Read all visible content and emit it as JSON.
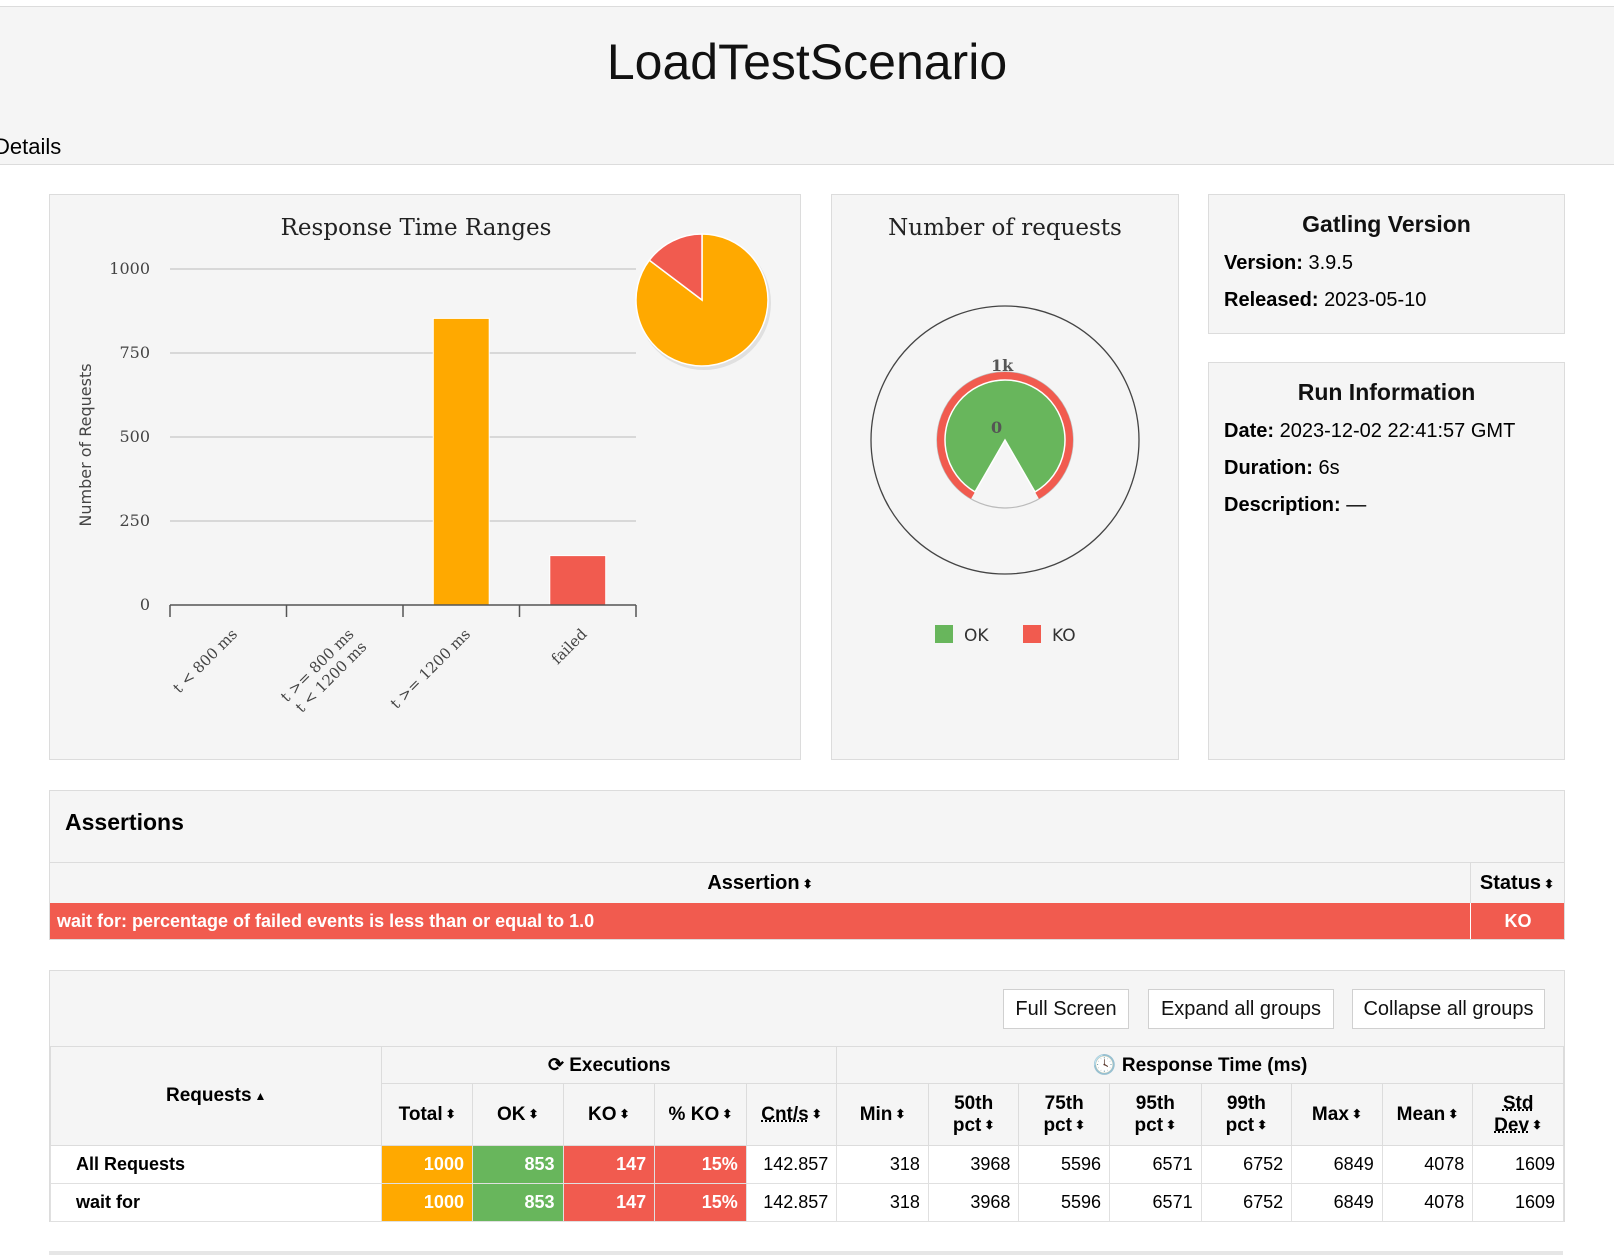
{
  "header": {
    "title": "LoadTestScenario",
    "tab": "Details"
  },
  "chart_data": [
    {
      "type": "bar",
      "title": "Response Time Ranges",
      "ylabel": "Number of Requests",
      "xlabel": "",
      "categories": [
        "t < 800 ms",
        "t >= 800 ms\nt < 1200 ms",
        "t >= 1200 ms",
        "failed"
      ],
      "values": [
        0,
        0,
        853,
        147
      ],
      "colors": [
        "#68b65c",
        "#ffdd00",
        "#ffa900",
        "#f15b4f"
      ],
      "ylim": [
        0,
        1000
      ],
      "yticks": [
        0,
        250,
        500,
        750,
        1000
      ],
      "grid": true,
      "pie": {
        "values": [
          853,
          147
        ],
        "colors": [
          "#ffa900",
          "#f15b4f"
        ]
      }
    },
    {
      "type": "pie",
      "title": "Number of requests",
      "gauge_labels": {
        "max": "1k",
        "min": "0"
      },
      "values": [
        853,
        147
      ],
      "legend": [
        "OK",
        "KO"
      ],
      "colors": [
        "#68b65c",
        "#f15b4f"
      ]
    }
  ],
  "gatling": {
    "title": "Gatling Version",
    "version_label": "Version:",
    "version": "3.9.5",
    "released_label": "Released:",
    "released": "2023-05-10"
  },
  "run": {
    "title": "Run Information",
    "date_label": "Date:",
    "date": "2023-12-02 22:41:57 GMT",
    "duration_label": "Duration:",
    "duration": "6s",
    "description_label": "Description:",
    "description": "—"
  },
  "assertions": {
    "title": "Assertions",
    "col_assertion": "Assertion",
    "col_status": "Status",
    "rows": [
      {
        "text": "wait for: percentage of failed events is less than or equal to 1.0",
        "status": "KO"
      }
    ]
  },
  "stats": {
    "buttons": {
      "full": "Full Screen",
      "expand": "Expand all groups",
      "collapse": "Collapse all groups"
    },
    "group_executions": "Executions",
    "group_response": "Response Time (ms)",
    "col_requests": "Requests",
    "cols": {
      "total": "Total",
      "ok": "OK",
      "ko": "KO",
      "pct_ko": "% KO",
      "cnt": "Cnt/s",
      "min": "Min",
      "p50a": "50th",
      "p50b": "pct",
      "p75a": "75th",
      "p75b": "pct",
      "p95a": "95th",
      "p95b": "pct",
      "p99a": "99th",
      "p99b": "pct",
      "max": "Max",
      "mean": "Mean",
      "stda": "Std",
      "stdb": "Dev"
    },
    "rows": [
      {
        "name": "All Requests",
        "total": "1000",
        "ok": "853",
        "ko": "147",
        "pct": "15%",
        "cnt": "142.857",
        "min": "318",
        "p50": "3968",
        "p75": "5596",
        "p95": "6571",
        "p99": "6752",
        "max": "6849",
        "mean": "4078",
        "std": "1609"
      },
      {
        "name": "wait for",
        "total": "1000",
        "ok": "853",
        "ko": "147",
        "pct": "15%",
        "cnt": "142.857",
        "min": "318",
        "p50": "3968",
        "p75": "5596",
        "p95": "6571",
        "p99": "6752",
        "max": "6849",
        "mean": "4078",
        "std": "1609"
      }
    ]
  }
}
